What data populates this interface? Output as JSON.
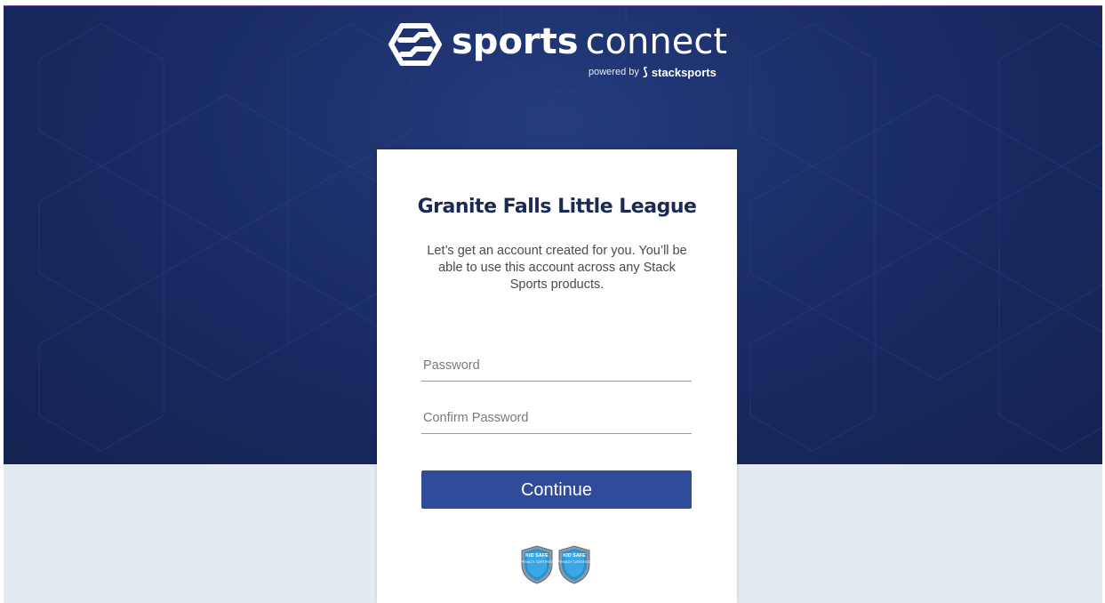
{
  "brand": {
    "word_bold": "sports",
    "word_light": "connect",
    "powered_by": "powered by",
    "partner_name": "stacksports"
  },
  "card": {
    "title": "Granite Falls Little League",
    "description": "Let’s get an account created for you. You’ll be able to use this account across any Stack Sports products."
  },
  "form": {
    "password_placeholder": "Password",
    "password_value": "",
    "confirm_placeholder": "Confirm Password",
    "confirm_value": "",
    "continue_label": "Continue"
  },
  "badges": [
    {
      "label": "KID SAFE",
      "sub": "PRIVACY CERTIFIED",
      "icon": "kidsafe-shield-icon"
    },
    {
      "label": "KID SAFE",
      "sub": "PRIVACY CERTIFIED",
      "icon": "kidsafe-shield-icon"
    }
  ],
  "colors": {
    "hero_bg": "#152a66",
    "page_bg": "#e3eaf2",
    "button": "#2f4b9a",
    "title": "#1a2a55"
  }
}
